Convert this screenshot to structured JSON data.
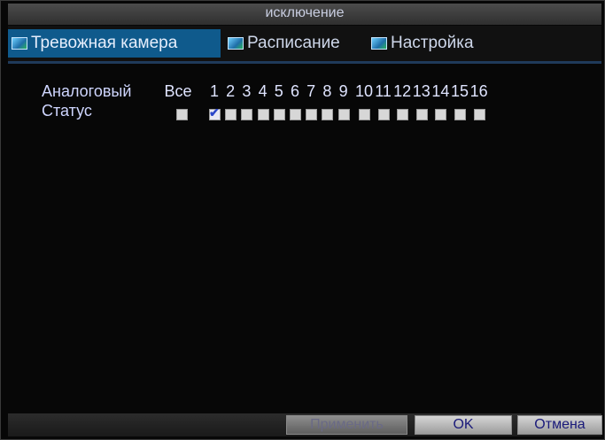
{
  "window": {
    "title": "исключение"
  },
  "tabs": [
    {
      "label": "Тревожная камера",
      "active": true
    },
    {
      "label": "Расписание",
      "active": false
    },
    {
      "label": "Настройка",
      "active": false
    }
  ],
  "grid": {
    "header_label": "Аналоговый",
    "all_label": "Все",
    "channels": [
      "1",
      "2",
      "3",
      "4",
      "5",
      "6",
      "7",
      "8",
      "9",
      "10",
      "11",
      "12",
      "13",
      "14",
      "15",
      "16"
    ],
    "status_label": "Статус",
    "all_checked": false,
    "channel_checked": [
      true,
      false,
      false,
      false,
      false,
      false,
      false,
      false,
      false,
      false,
      false,
      false,
      false,
      false,
      false,
      false
    ]
  },
  "buttons": {
    "apply": "Применить",
    "ok": "OK",
    "cancel": "Отмена"
  },
  "colors": {
    "tab_active": "#0f5a8c",
    "background": "#070707",
    "check_mark": "#2a46c8"
  }
}
